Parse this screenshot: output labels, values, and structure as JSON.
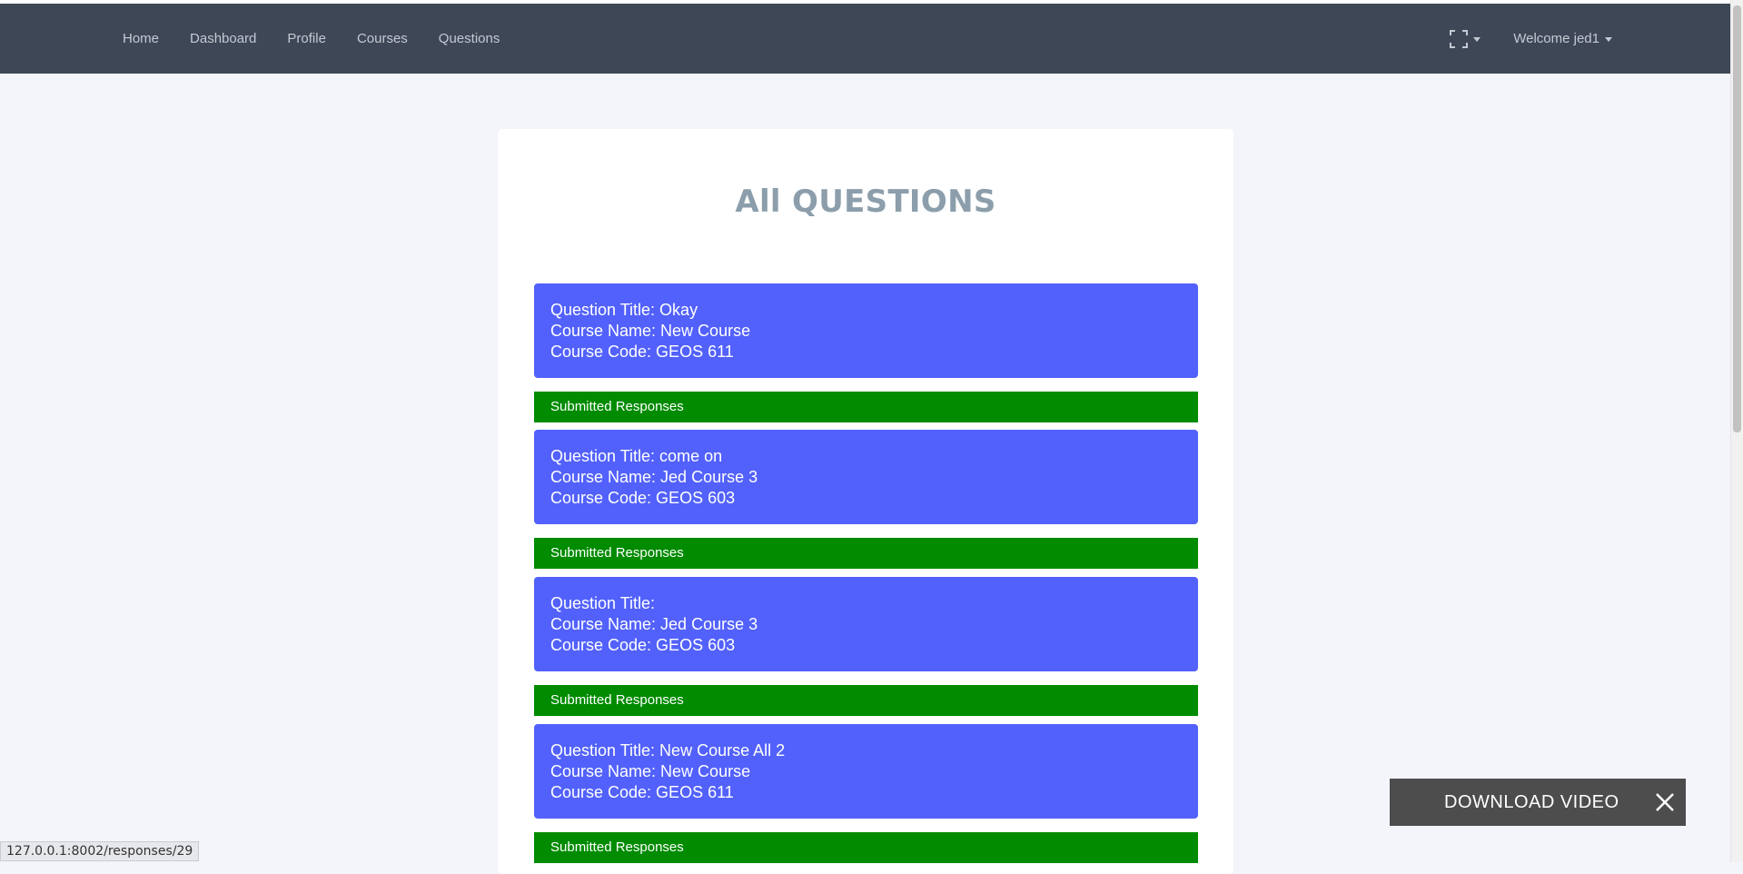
{
  "nav": {
    "links": [
      "Home",
      "Dashboard",
      "Profile",
      "Courses",
      "Questions"
    ],
    "welcome": "Welcome jed1"
  },
  "page": {
    "title": "All QUESTIONS"
  },
  "questions": [
    {
      "title": "Question Title: Okay",
      "course": "Course Name: New Course",
      "code": "Course Code: GEOS 611",
      "responses_label": "Submitted Responses"
    },
    {
      "title": "Question Title: come on",
      "course": "Course Name: Jed Course 3",
      "code": "Course Code: GEOS 603",
      "responses_label": "Submitted Responses"
    },
    {
      "title": "Question Title:",
      "course": "Course Name: Jed Course 3",
      "code": "Course Code: GEOS 603",
      "responses_label": "Submitted Responses"
    },
    {
      "title": "Question Title: New Course All 2",
      "course": "Course Name: New Course",
      "code": "Course Code: GEOS 611",
      "responses_label": "Submitted Responses"
    }
  ],
  "download": {
    "label": "DOWNLOAD VIDEO"
  },
  "status_bar": {
    "url": "127.0.0.1:8002/responses/29"
  },
  "colors": {
    "navbar": "#3e4756",
    "question_box": "#5261fb",
    "responses_bar": "#008b00",
    "title": "#8c9eab"
  },
  "icons": [
    "fullscreen-icon",
    "chevron-down-icon",
    "close-icon"
  ]
}
